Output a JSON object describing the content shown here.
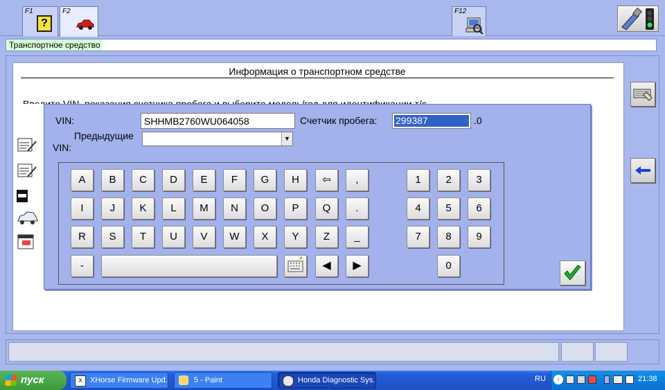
{
  "toolbar": {
    "f1_label": "F1",
    "f2_label": "F2",
    "f12_label": "F12"
  },
  "status_top": "Транспортное средство",
  "panel": {
    "title": "Информация о транспортном средстве",
    "instruction": "Введите VIN, показания счетчика пробега и выберите модель/год для идентификации т/с"
  },
  "dialog": {
    "vin_label": "VIN:",
    "vin_value": "SHHMB2760WU064058",
    "odometer_label": "Счетчик пробега:",
    "odometer_value": "299387",
    "odometer_suffix": ".0",
    "prev_vin_label_1": "Предыдущие",
    "prev_vin_label_2": "VIN:",
    "prev_vin_value": ""
  },
  "keyboard": {
    "row1": [
      "A",
      "B",
      "C",
      "D",
      "E",
      "F",
      "G",
      "H",
      "⇦",
      ","
    ],
    "row2": [
      "I",
      "J",
      "K",
      "L",
      "M",
      "N",
      "O",
      "P",
      "Q",
      "."
    ],
    "row3": [
      "R",
      "S",
      "T",
      "U",
      "V",
      "W",
      "X",
      "Y",
      "Z",
      "_"
    ],
    "minus": "-",
    "left_arrow": "◀",
    "right_arrow": "▶",
    "num_row1": [
      "1",
      "2",
      "3"
    ],
    "num_row2": [
      "4",
      "5",
      "6"
    ],
    "num_row3": [
      "7",
      "8",
      "9"
    ],
    "zero": "0"
  },
  "taskbar": {
    "start_label": "пуск",
    "items": [
      {
        "label": "XHorse Firmware Upd...",
        "icon": "xhorse-icon"
      },
      {
        "label": "5 - Paint",
        "icon": "paint-icon"
      },
      {
        "label": "Honda Diagnostic Sys...",
        "icon": "honda-icon"
      }
    ],
    "lang": "RU",
    "clock": "21:38"
  },
  "colors": {
    "desktop_bg": "#a9b8ec",
    "dialog_bg": "#a3b2ec",
    "odometer_highlight": "#3163c5",
    "status_bg": "#d7ffd7",
    "taskbar": "#245edb",
    "start": "#3c9a3c"
  }
}
